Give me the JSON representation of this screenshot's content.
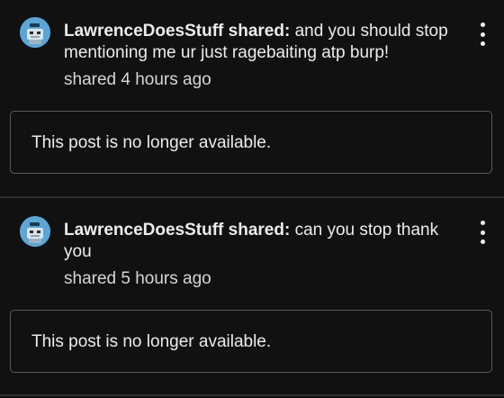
{
  "colors": {
    "background": "#111111",
    "text": "#ececec",
    "border": "#5a5a5a",
    "avatar": "#5aa6d6"
  },
  "posts": [
    {
      "author": "LawrenceDoesStuff shared:",
      "message": " and you should stop mentioning me ur just ragebaiting atp burp!",
      "time": "shared 4 hours ago",
      "unavailable_text": "This post is no longer available.",
      "avatar_icon": "robot-avatar-icon",
      "menu_icon": "more-vert-icon"
    },
    {
      "author": "LawrenceDoesStuff shared:",
      "message": " can you stop thank you",
      "time": "shared 5 hours ago",
      "unavailable_text": "This post is no longer available.",
      "avatar_icon": "robot-avatar-icon",
      "menu_icon": "more-vert-icon"
    }
  ]
}
